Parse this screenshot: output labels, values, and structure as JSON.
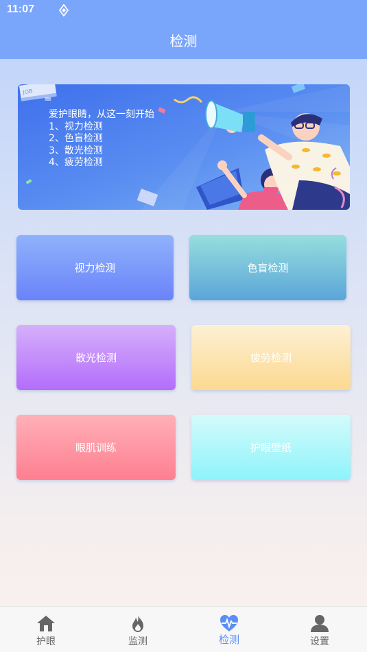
{
  "status_bar": {
    "time": "11:07",
    "app_icon": "navigation-diamond-icon"
  },
  "header": {
    "title": "检测"
  },
  "banner": {
    "dash": "=",
    "intro": "爱护眼睛，从这一刻开始",
    "items": [
      "1、视力检测",
      "2、色盲检测",
      "3、散光检测",
      "4、疲劳检测"
    ],
    "illustration": "megaphone-people-illustration",
    "book_label": "JOB",
    "book_label2": "BOL"
  },
  "tiles": [
    {
      "label": "视力检测"
    },
    {
      "label": "色盲检测"
    },
    {
      "label": "散光检测"
    },
    {
      "label": "疲劳检测"
    },
    {
      "label": "眼肌训练"
    },
    {
      "label": "护眼壁纸"
    }
  ],
  "tabbar": {
    "items": [
      {
        "label": "护眼",
        "icon": "home-icon"
      },
      {
        "label": "监测",
        "icon": "flame-icon"
      },
      {
        "label": "检测",
        "icon": "heart-pulse-icon",
        "active": true
      },
      {
        "label": "设置",
        "icon": "person-icon"
      }
    ]
  },
  "colors": {
    "header": "#79a5fb",
    "active_tab": "#5a8ef8",
    "inactive_tab": "#666666"
  }
}
